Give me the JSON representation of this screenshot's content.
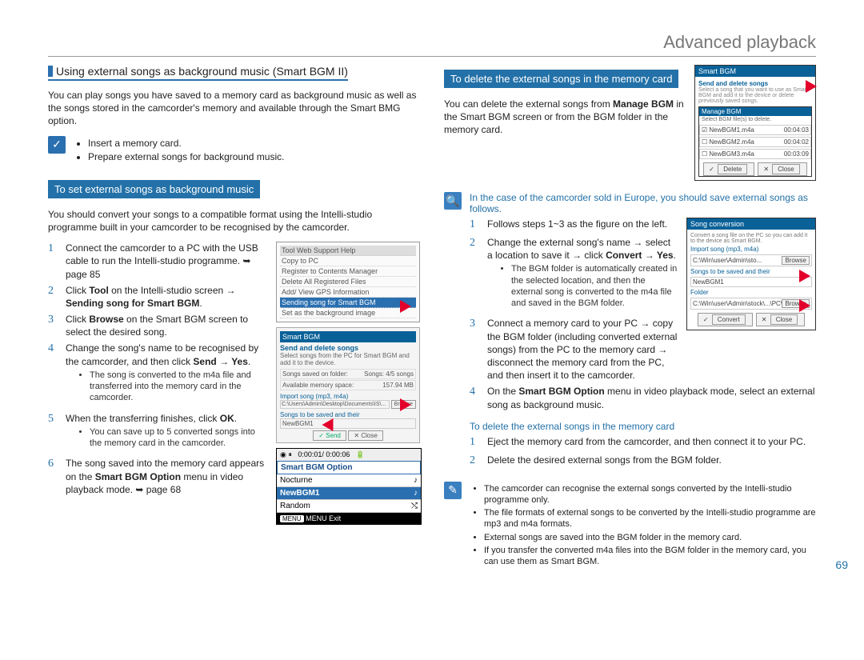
{
  "page": {
    "title": "Advanced playback",
    "number": "69"
  },
  "left": {
    "section_title": "Using external songs as background music (Smart BGM II)",
    "intro": "You can play songs you have saved to a memory card as background music as well as the songs stored in the camcorder's memory and available through the Smart BMG option.",
    "prep": {
      "items": [
        "Insert a memory card.",
        "Prepare external songs for background music."
      ]
    },
    "subhead": "To set external songs as background music",
    "lead": "You should convert your songs to a compatible format using the Intelli-studio programme built in your camcorder to be recognised by the camcorder.",
    "steps": {
      "s1": "Connect the camcorder to a PC with the USB cable to run the Intelli-studio programme. ➥ page 85",
      "s2_pre": "Click ",
      "s2_b1": "Tool",
      "s2_mid": " on the Intelli-studio screen → ",
      "s2_b2": "Sending song for Smart BGM",
      "s2_post": ".",
      "s3_pre": "Click ",
      "s3_b1": "Browse",
      "s3_post": " on the Smart BGM screen to select the desired song.",
      "s4_pre": "Change the song's name to be recognised by the camcorder, and then click ",
      "s4_b1": "Send → Yes",
      "s4_post": ".",
      "s4_sub1": "The song is converted to the m4a file and transferred into the memory card in the camcorder.",
      "s5_pre": "When the transferring finishes, click ",
      "s5_b1": "OK",
      "s5_post": ".",
      "s5_sub1": "You can save up to 5 converted songs into the memory card in the camcorder.",
      "s6_pre": "The song saved into the memory card appears on the ",
      "s6_b1": "Smart BGM Option",
      "s6_post": " menu in video playback mode. ➥ page 68"
    },
    "mock": {
      "tool_menu": {
        "header": "Tool   Web Support   Help",
        "items": [
          "Copy to PC",
          "Register to Contents Manager",
          "Delete All Registered Files",
          "Add/ View GPS Information",
          "Sending song for Smart BGM",
          "Set as the background image"
        ]
      },
      "smartbgm_window": {
        "title": "Smart BGM",
        "sec1": "Send and delete songs",
        "desc": "Select songs from the PC for Smart BGM and add it to the device.",
        "field1_label": "Songs saved on folder:",
        "field1_val": "Songs: 4/5 songs",
        "field2_label": "Available memory space:",
        "field2_val": "157.94 MB",
        "import_label": "Import song (mp3, m4a)",
        "path": "C:\\Users\\Admin\\Desktop\\Documents\\IS\\...",
        "browse": "Browse",
        "saved_label": "Songs to be saved and their",
        "newbgm": "NewBGM1",
        "send": "Send",
        "close": "Close"
      },
      "bgm_option": {
        "timebar": "0:00:01/ 0:00:06",
        "title": "Smart BGM Option",
        "items": [
          "Nocturne",
          "NewBGM1",
          "Random"
        ],
        "exit": "MENU Exit"
      }
    }
  },
  "right": {
    "subhead": "To delete the external songs in the memory card",
    "intro_pre": "You can delete the external songs from ",
    "intro_b1": "Manage BGM",
    "intro_post": " in the Smart BGM screen or from the BGM folder in the memory card.",
    "del_window": {
      "title": "Smart BGM",
      "sec": "Send and delete songs",
      "desc": "Select a song that you want to use as Smart BGM and add it to the device or delete previously saved songs.",
      "mgr": "Manage BGM",
      "mgr_desc": "Select BGM file(s) to delete.",
      "rows": [
        {
          "name": "NewBGM1.m4a",
          "size": "00:04:03"
        },
        {
          "name": "NewBGM2.m4a",
          "size": "00:04:02"
        },
        {
          "name": "NewBGM3.m4a",
          "size": "00:03:09"
        }
      ],
      "delete": "Delete",
      "close": "Close"
    },
    "eu_note": "In the case of the camcorder sold in Europe, you should save external songs as follows.",
    "eu_steps": {
      "s1": "Follows steps 1~3 as the figure on the left.",
      "s2_pre": "Change the external song's name → select a location to save it → click ",
      "s2_b1": "Convert → Yes",
      "s2_post": ".",
      "s2_sub1": "The BGM folder is automatically created in the selected location, and then the external song is converted to the m4a file and saved in the BGM folder.",
      "s3": "Connect a memory card to your PC → copy the BGM folder (including converted external songs) from the PC to the memory card → disconnect the memory card from the PC, and then insert it to the camcorder.",
      "s4_pre": "On the ",
      "s4_b1": "Smart BGM Option",
      "s4_post": " menu in video playback mode, select an external song as background music."
    },
    "songconv": {
      "title": "Song conversion",
      "desc": "Convert a song file on the PC so you can add it to the device as Smart BGM.",
      "import_label": "Import song (mp3, m4a)",
      "path1": "C:\\Win\\user\\Admin\\sto...",
      "browse": "Browse",
      "saved_label": "Songs to be saved and their",
      "newbgm": "NewBGM1",
      "folder_label": "Folder",
      "path2": "C:\\Win\\user\\Admin\\stock\\...\\PC\\Documents\\W...",
      "convert": "Convert",
      "close": "Close"
    },
    "del_subhead": "To delete the external songs in the memory card",
    "del_steps": {
      "s1": "Eject the memory card from the camcorder, and then connect it to your PC.",
      "s2": "Delete the desired external songs from the BGM folder."
    },
    "tips": [
      "The camcorder can recognise the external songs converted by the Intelli-studio programme only.",
      "The file formats of external songs to be converted by the Intelli-studio programme are mp3 and m4a formats.",
      "External songs are saved into the BGM folder in the memory card.",
      "If you transfer the converted m4a files into the BGM folder in the memory card, you can use them as Smart BGM."
    ]
  }
}
